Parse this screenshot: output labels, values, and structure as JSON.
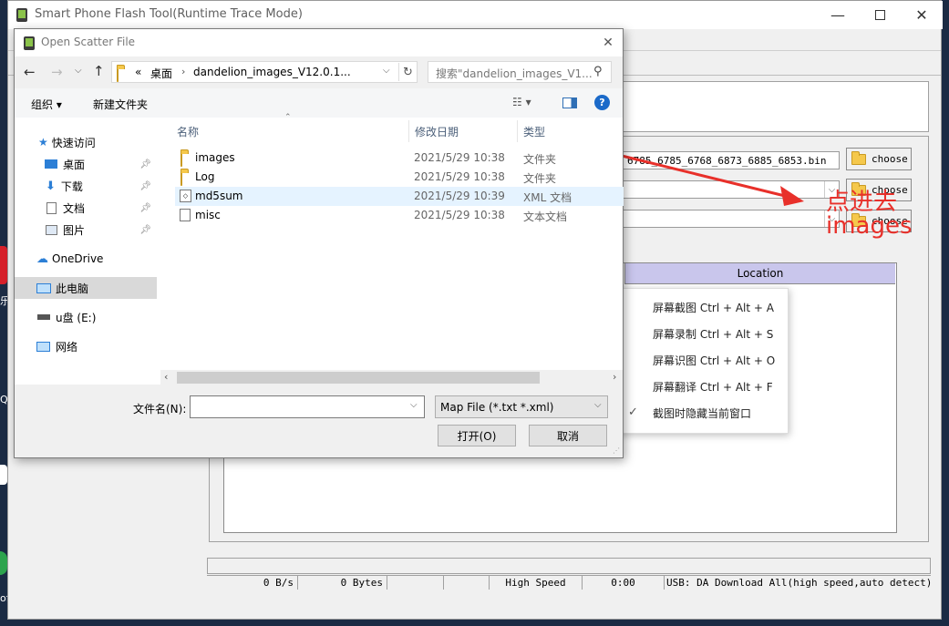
{
  "main_window": {
    "title": "Smart Phone Flash Tool(Runtime Trace Mode)",
    "minimize_icon": "minimize-icon",
    "maximize_icon": "maximize-icon",
    "close_icon": "close-icon",
    "scatter_path_fragment": "6785_6785_6768_6873_6885_6853.bin",
    "choose_label": "choose",
    "table_header_location": "Location",
    "status": {
      "speed": "0 B/s",
      "bytes": "0 Bytes",
      "mode": "High Speed",
      "time": "0:00",
      "usb": "USB: DA Download All(high speed,auto detect)"
    }
  },
  "annotation": {
    "text_line1": "点进去",
    "text_line2": "images",
    "color": "#e8302a"
  },
  "dialog": {
    "title": "Open Scatter File",
    "address": {
      "prefix": "«",
      "crumb1": "桌面",
      "crumb2": "dandelion_images_V12.0.1..."
    },
    "search_placeholder": "搜索\"dandelion_images_V1...",
    "toolbar": {
      "organize": "组织 ▾",
      "new_folder": "新建文件夹"
    },
    "columns": {
      "name": "名称",
      "modified": "修改日期",
      "type": "类型"
    },
    "nav": {
      "quick_access": "快速访问",
      "desktop": "桌面",
      "downloads": "下载",
      "documents": "文档",
      "pictures": "图片",
      "onedrive": "OneDrive",
      "this_pc": "此电脑",
      "usb_drive": "u盘 (E:)",
      "network": "网络"
    },
    "files": [
      {
        "name": "images",
        "date": "2021/5/29 10:38",
        "type": "文件夹",
        "icon": "folder-icon"
      },
      {
        "name": "Log",
        "date": "2021/5/29 10:38",
        "type": "文件夹",
        "icon": "folder-icon"
      },
      {
        "name": "md5sum",
        "date": "2021/5/29 10:39",
        "type": "XML 文档",
        "icon": "xml-file-icon"
      },
      {
        "name": "misc",
        "date": "2021/5/29 10:38",
        "type": "文本文档",
        "icon": "text-file-icon"
      }
    ],
    "filename_label": "文件名(N):",
    "filename_value": "",
    "filter_value": "Map File (*.txt *.xml)",
    "open_button": "打开(O)",
    "cancel_button": "取消"
  },
  "context_menu": {
    "items": [
      "屏幕截图 Ctrl + Alt + A",
      "屏幕录制 Ctrl + Alt + S",
      "屏幕识图 Ctrl + Alt + O",
      "屏幕翻译 Ctrl + Alt + F",
      "截图时隐藏当前窗口"
    ],
    "checked_index": 4
  }
}
